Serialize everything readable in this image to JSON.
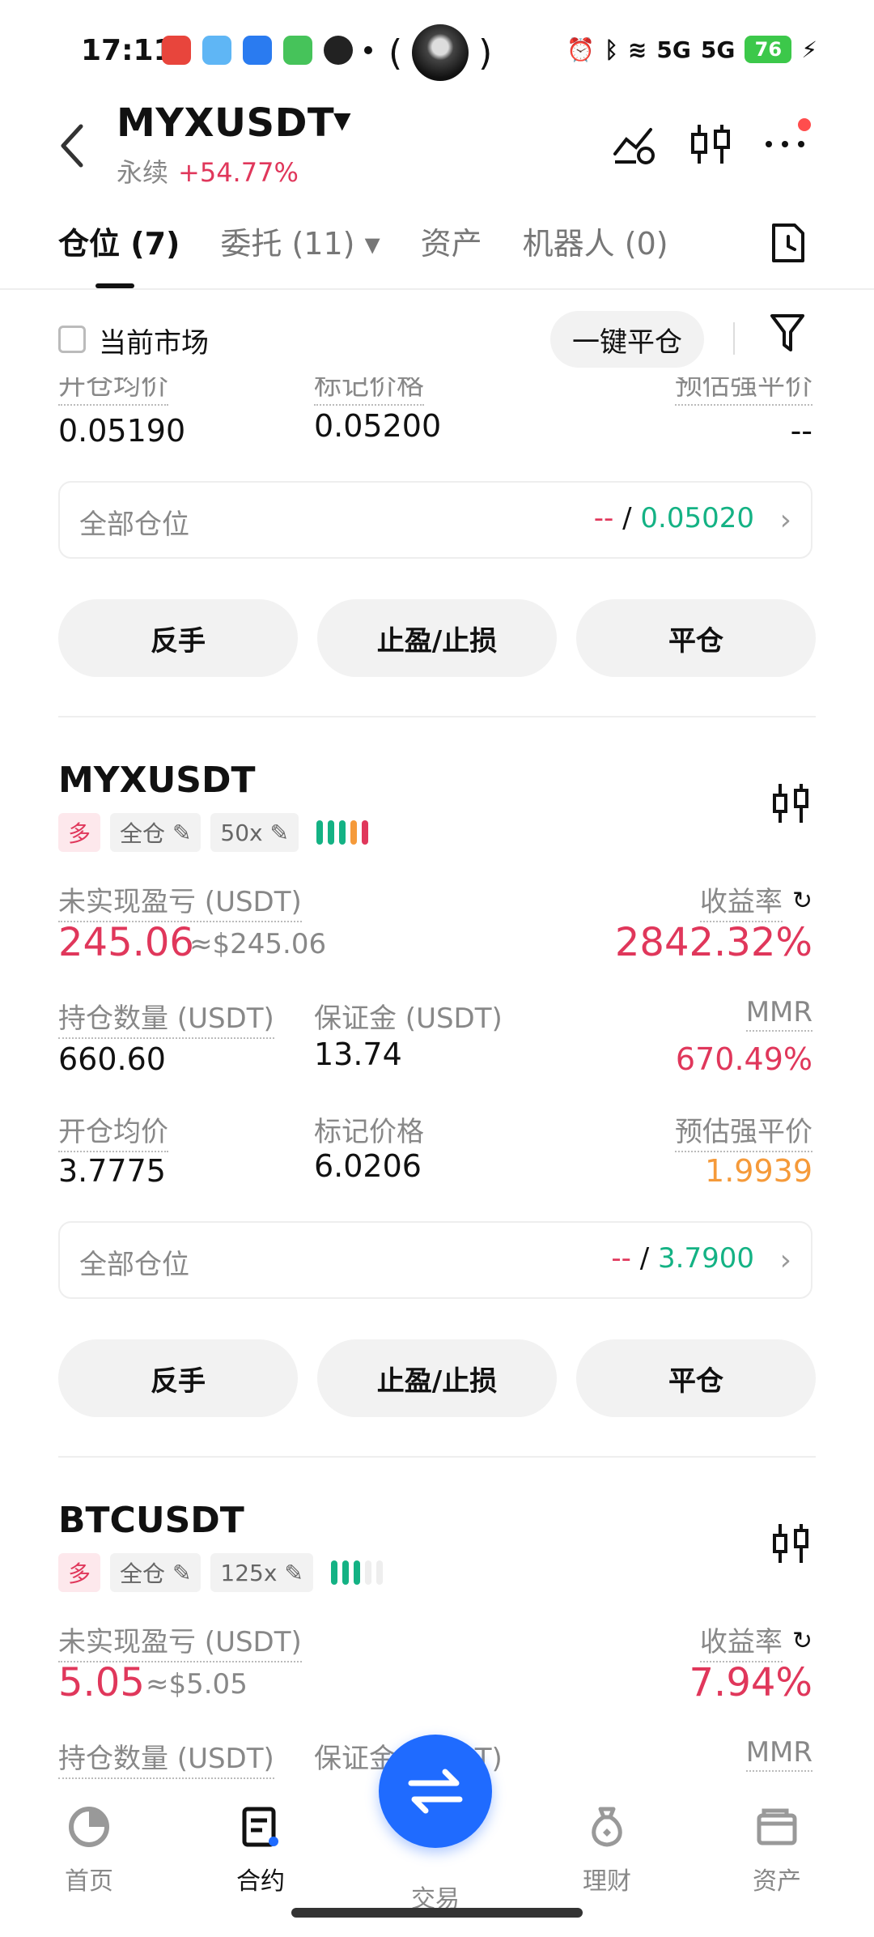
{
  "status": {
    "time": "17:11",
    "battery": "76",
    "net1": "5G",
    "net2": "5G"
  },
  "header": {
    "title": "MYXUSDT",
    "subtitle": "永续",
    "change": "+54.77%"
  },
  "tabs": [
    {
      "label": "仓位 (7)"
    },
    {
      "label": "委托 (11) ▾"
    },
    {
      "label": "资产"
    },
    {
      "label": "机器人 (0)"
    }
  ],
  "filter": {
    "current_market": "当前市场",
    "one_click_close": "一键平仓"
  },
  "top_card": {
    "labels": [
      "开仓均价",
      "标记价格",
      "预估强平价"
    ],
    "entry": "0.05190",
    "mark": "0.05200",
    "liq": "--",
    "all_positions_label": "全部仓位",
    "all_dash": "--",
    "all_value": "0.05020",
    "actions": [
      "反手",
      "止盈/止损",
      "平仓"
    ]
  },
  "myx": {
    "symbol": "MYXUSDT",
    "side": "多",
    "mode": "全仓",
    "leverage": "50x",
    "pnl_label": "未实现盈亏 (USDT)",
    "pnl": "245.06",
    "pnl_usd": "≈$245.06",
    "roe_label": "收益率",
    "roe": "2842.32%",
    "qty_label": "持仓数量 (USDT)",
    "qty": "660.60",
    "margin_label": "保证金 (USDT)",
    "margin": "13.74",
    "mmr_label": "MMR",
    "mmr": "670.49%",
    "entry_label": "开仓均价",
    "entry": "3.7775",
    "mark_label": "标记价格",
    "mark": "6.0206",
    "liq_label": "预估强平价",
    "liq": "1.9939",
    "all_positions_label": "全部仓位",
    "all_dash": "--",
    "all_value": "3.7900",
    "actions": [
      "反手",
      "止盈/止损",
      "平仓"
    ]
  },
  "btc": {
    "symbol": "BTCUSDT",
    "side": "多",
    "mode": "全仓",
    "leverage": "125x",
    "pnl_label": "未实现盈亏 (USDT)",
    "pnl": "5.05",
    "pnl_usd": "≈$5.05",
    "roe_label": "收益率",
    "roe": "7.94%",
    "qty_label": "持仓数量 (USDT)",
    "margin_label": "保证金 (USDT)",
    "mmr_label": "MMR"
  },
  "nav": [
    {
      "label": "首页"
    },
    {
      "label": "合约"
    },
    {
      "label": "交易"
    },
    {
      "label": "理财"
    },
    {
      "label": "资产"
    }
  ],
  "colors": {
    "red": "#e0375b",
    "green": "#14b284",
    "orange": "#f59a3a",
    "blue": "#1f6bff"
  }
}
